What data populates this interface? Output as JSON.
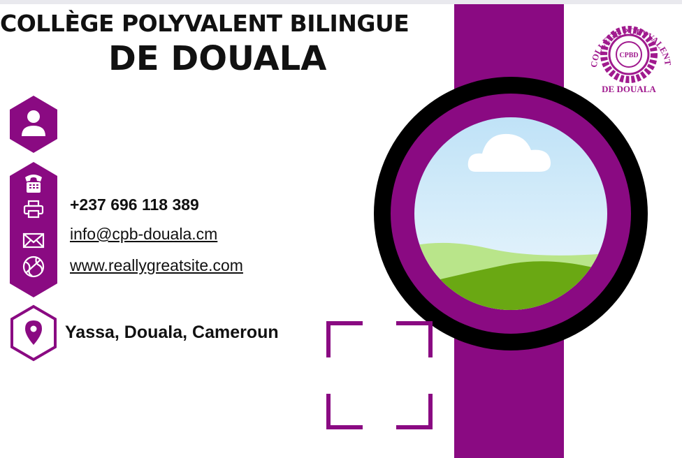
{
  "school": {
    "name_line1": "COLLÈGE POLYVALENT BILINGUE",
    "name_line2": "DE DOUALA"
  },
  "contact": {
    "phone": "+237 696 118 389",
    "email": "info@cpb-douala.cm",
    "website": "www.reallygreatsite.com",
    "address": "Yassa, Douala, Cameroun"
  },
  "logo": {
    "arc_text": "COLLEGE POLYVALENT BILINGUE",
    "bottom_text": "DE DOUALA",
    "center_text": "CPBD"
  },
  "colors": {
    "accent": "#8a0a82",
    "ring": "#000000",
    "sky": "#cfe9f9",
    "hill_light": "#b9e58a",
    "hill_dark": "#6aa813"
  },
  "icons": [
    "user-icon",
    "telephone-icon",
    "fax-icon",
    "mail-icon",
    "globe-icon",
    "location-pin-icon"
  ]
}
